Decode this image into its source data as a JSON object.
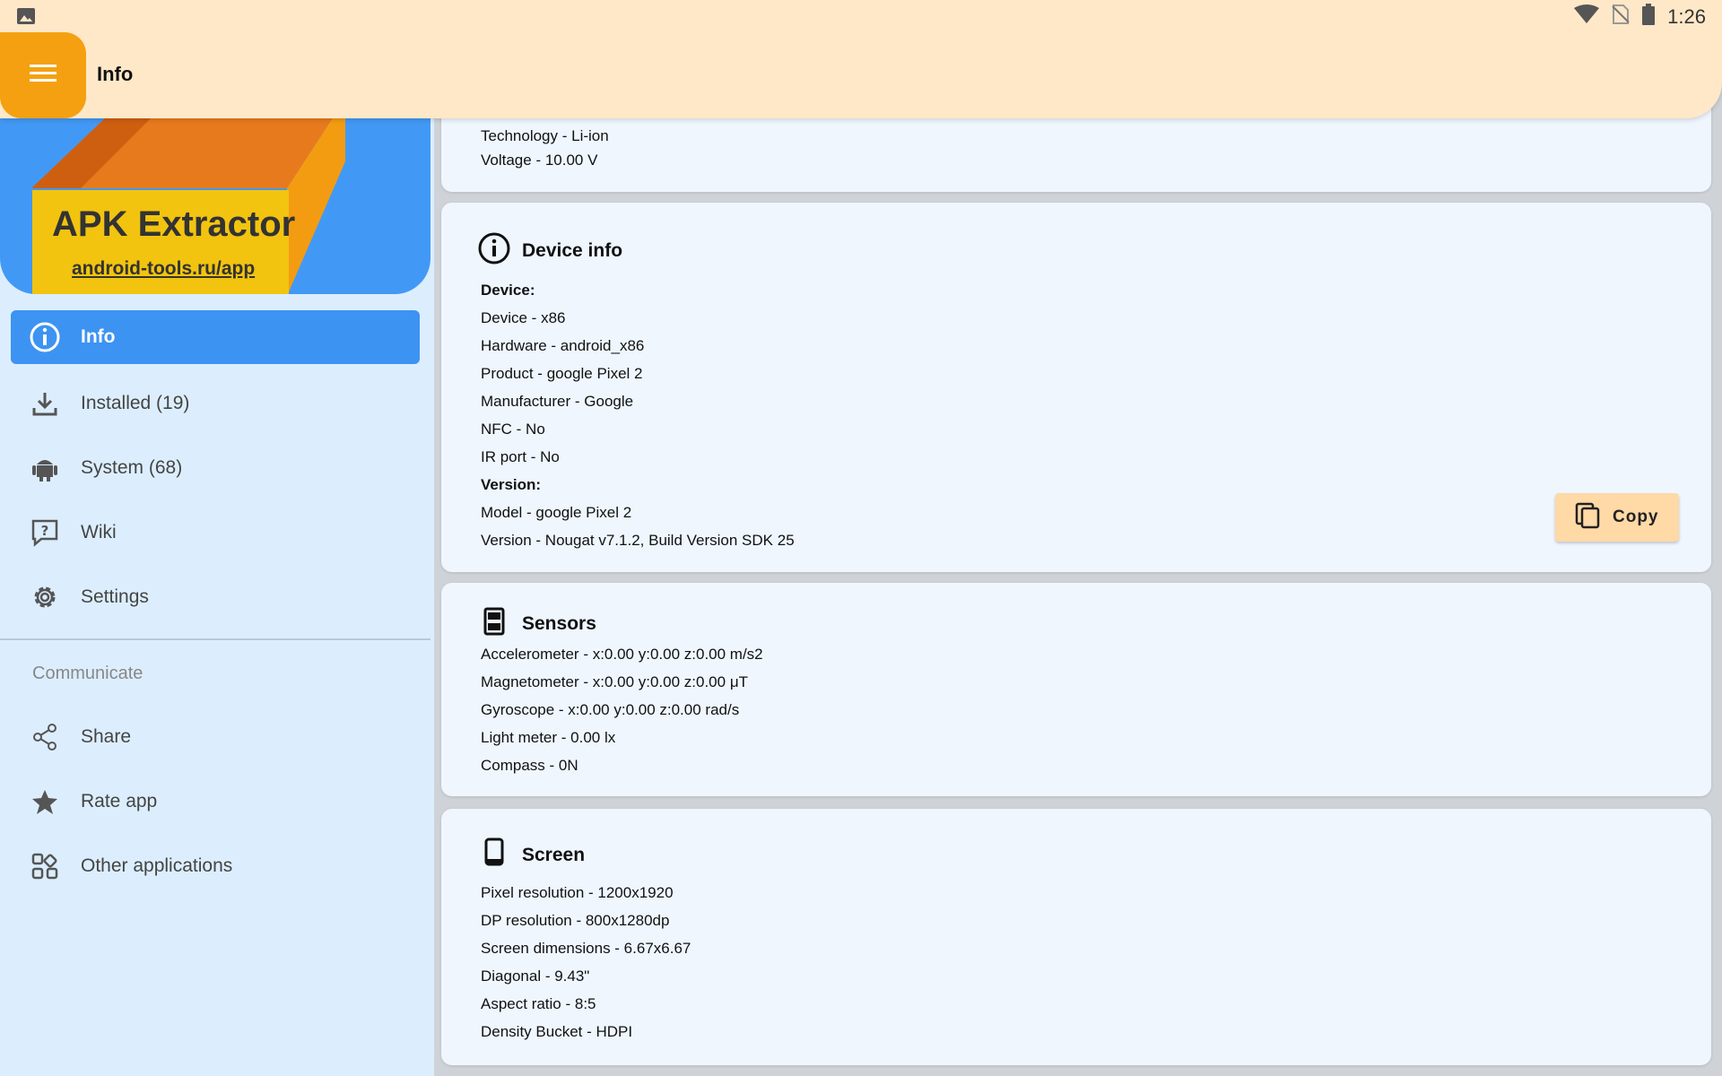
{
  "status_bar": {
    "time": "1:26",
    "icons": [
      "image-icon",
      "wifi-icon",
      "no-sim-icon",
      "battery-icon"
    ]
  },
  "app_bar": {
    "title": "Info",
    "menu_icon": "hamburger-icon"
  },
  "drawer": {
    "banner": {
      "title": "APK Extractor",
      "link": "android-tools.ru/app"
    },
    "items": [
      {
        "label": "Info",
        "icon": "info-icon",
        "active": true
      },
      {
        "label": "Installed (19)",
        "icon": "download-icon"
      },
      {
        "label": "System (68)",
        "icon": "android-icon"
      },
      {
        "label": "Wiki",
        "icon": "help-icon"
      },
      {
        "label": "Settings",
        "icon": "gear-icon"
      }
    ],
    "section_label": "Communicate",
    "communicate_items": [
      {
        "label": "Share",
        "icon": "share-icon"
      },
      {
        "label": "Rate app",
        "icon": "star-icon"
      },
      {
        "label": "Other applications",
        "icon": "apps-icon"
      }
    ]
  },
  "battery_card": {
    "lines": [
      "Technology - Li-ion",
      "Voltage - 10.00 V"
    ]
  },
  "device_card": {
    "title": "Device info",
    "icon": "info-icon",
    "lines": [
      "Device:",
      "Device - x86",
      "Hardware - android_x86",
      "Product - google Pixel 2",
      "Manufacturer - Google",
      "NFC - No",
      "IR port - No",
      "Version:",
      "Model - google Pixel 2",
      "Version - Nougat v7.1.2, Build Version SDK 25"
    ],
    "copy_label": "Copy",
    "copy_icon": "copy-icon"
  },
  "sensors_card": {
    "title": "Sensors",
    "icon": "sensor-icon",
    "lines": [
      "Accelerometer - x:0.00 y:0.00 z:0.00 m/s2",
      "Magnetometer - x:0.00 y:0.00 z:0.00 μT",
      "Gyroscope - x:0.00 y:0.00 z:0.00 rad/s",
      "Light meter - 0.00 lx",
      "Compass - 0N"
    ]
  },
  "screen_card": {
    "title": "Screen",
    "icon": "tablet-icon",
    "lines": [
      "Pixel resolution - 1200x1920",
      "DP resolution - 800x1280dp",
      "Screen dimensions - 6.67x6.67",
      "Diagonal - 9.43\"",
      "Aspect ratio - 8:5",
      "Density Bucket - HDPI"
    ]
  },
  "colors": {
    "accent": "#f5a010",
    "app_bar": "#ffe8c8",
    "drawer_bg": "#dceefd",
    "active_item": "#3d93f2",
    "card_bg": "#eff6fe"
  }
}
